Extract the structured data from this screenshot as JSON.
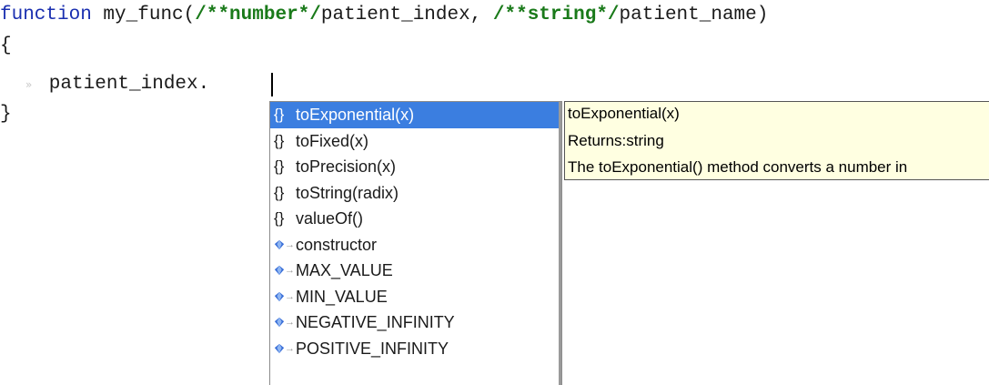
{
  "code": {
    "line1": {
      "keyword": "function",
      "fn_head": " my_func(",
      "comment1": "/**number*/",
      "param1": "patient_index, ",
      "comment2": "/**string*/",
      "param2": "patient_name)"
    },
    "line2": "{",
    "line3_indent_glyph": "»",
    "line3": "   patient_index.",
    "line4": "}"
  },
  "completion": {
    "items": [
      {
        "icon": "method-braces-icon",
        "glyph": "{}",
        "label": "toExponential(x)",
        "selected": true
      },
      {
        "icon": "method-braces-icon",
        "glyph": "{}",
        "label": "toFixed(x)",
        "selected": false
      },
      {
        "icon": "method-braces-icon",
        "glyph": "{}",
        "label": "toPrecision(x)",
        "selected": false
      },
      {
        "icon": "method-braces-icon",
        "glyph": "{}",
        "label": "toString(radix)",
        "selected": false
      },
      {
        "icon": "method-braces-icon",
        "glyph": "{}",
        "label": "valueOf()",
        "selected": false
      },
      {
        "icon": "property-gem-icon",
        "label": "constructor",
        "selected": false
      },
      {
        "icon": "property-gem-icon",
        "label": "MAX_VALUE",
        "selected": false
      },
      {
        "icon": "property-gem-icon",
        "label": "MIN_VALUE",
        "selected": false
      },
      {
        "icon": "property-gem-icon",
        "label": "NEGATIVE_INFINITY",
        "selected": false
      },
      {
        "icon": "property-gem-icon",
        "label": "POSITIVE_INFINITY",
        "selected": false
      }
    ],
    "selected_bg": "#3b7ee0",
    "property_icon_color": "#3a6fd8"
  },
  "tooltip": {
    "signature": "toExponential(x)",
    "returns": "Returns:string",
    "description": "The toExponential() method converts a number in"
  }
}
